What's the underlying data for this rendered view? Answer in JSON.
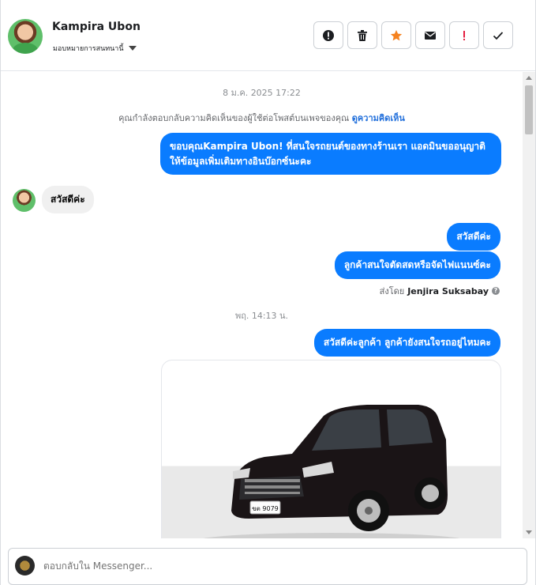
{
  "header": {
    "contact_name": "Kampira Ubon",
    "assign_label": "มอบหมายการสนทนานี้",
    "actions": [
      {
        "name": "report-spam",
        "icon": "alert-circle-icon"
      },
      {
        "name": "delete",
        "icon": "trash-icon"
      },
      {
        "name": "star",
        "icon": "star-icon"
      },
      {
        "name": "mark-unread",
        "icon": "envelope-icon"
      },
      {
        "name": "follow-up",
        "icon": "exclamation-icon"
      },
      {
        "name": "mark-done",
        "icon": "check-icon"
      }
    ],
    "star_color": "#f5821f",
    "follow_up_color": "#e41e3f"
  },
  "conversation": {
    "timestamp_1": "8 ม.ค. 2025 17:22",
    "info_text": "คุณกำลังตอบกลับความคิดเห็นของผู้ใช้ต่อโพสต์บนเพจของคุณ",
    "info_link": "ดูความคิดเห็น",
    "msg_1": "ขอบคุณKampira Ubon! ที่สนใจรถยนต์ของทางร้านเรา แอดมินขออนุญาติ ให้ข้อมูลเพิ่มเติมทางอินบ๊อกซ์นะคะ",
    "msg_incoming": "สวัสดีค่ะ",
    "msg_2": "สวัสดีค่ะ",
    "msg_3": "ลูกค้าสนใจตัดสดหรือจัดไฟแนนซ์คะ",
    "sent_by_label": "ส่งโดย",
    "sent_by_name": "Jenjira Suksabay",
    "timestamp_2": "พฤ. 14:13 น.",
    "msg_4": "สวัสดีค่ะลูกค้า ลูกค้ายังสนใจรถอยู่ไหมคะ",
    "plate_text": "ขต 9079",
    "outgoing_color": "#0a7cff"
  },
  "composer": {
    "placeholder": "ตอบกลับใน Messenger..."
  }
}
